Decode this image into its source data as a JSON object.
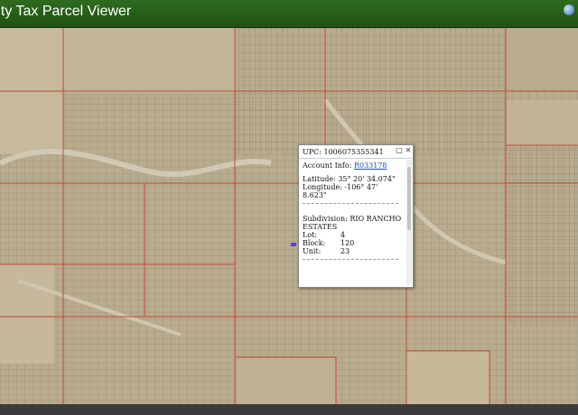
{
  "app": {
    "title": "nty Tax Parcel Viewer"
  },
  "popup": {
    "upc_text": "UPC: 1006075355341",
    "account_label": "Account Info:",
    "account_link": "R033178",
    "latitude": "Latitude: 35° 20' 34.074\"",
    "longitude_1": "Longitude: -106° 47'",
    "longitude_2": "8.623\"",
    "subdivision_1": "Subdivision: RIO RANCHO",
    "subdivision_2": "ESTATES",
    "lot_label": "Lot:",
    "lot_value": "4",
    "block_label": "Block:",
    "block_value": "120",
    "unit_label": "Unit:",
    "unit_value": "23",
    "maximize_glyph": "□",
    "close_glyph": "✕"
  },
  "icons": {
    "globe": "globe-icon",
    "maximize": "maximize-icon",
    "close": "close-icon"
  },
  "colors": {
    "header_green": "#2f6b1f",
    "parcel_lines": "#c34a3a",
    "terrain": "#b7a88b",
    "link": "#1a4fb5"
  }
}
